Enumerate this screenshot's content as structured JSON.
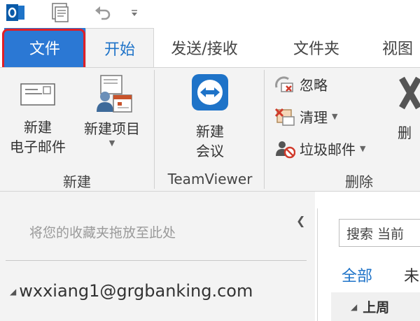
{
  "quick_access": {
    "app_icon": "outlook-icon",
    "icons": [
      "send-receive-icon",
      "undo-icon",
      "customize-dropdown-icon"
    ]
  },
  "tabs": {
    "file": "文件",
    "home": "开始",
    "send_receive": "发送/接收",
    "folder": "文件夹",
    "view": "视图"
  },
  "ribbon": {
    "new_group": {
      "new_email": [
        "新建",
        "电子邮件"
      ],
      "new_items": "新建项目",
      "label": "新建"
    },
    "teamviewer_group": {
      "new_meeting": [
        "新建",
        "会议"
      ],
      "label": "TeamViewer"
    },
    "delete_group": {
      "ignore": "忽略",
      "clean_up": "清理",
      "junk": "垃圾邮件",
      "delete": "删",
      "label": "删除"
    }
  },
  "nav_pane": {
    "favorites_hint": "将您的收藏夹拖放至此处",
    "account": "wxxiang1@grgbanking.com"
  },
  "message_list": {
    "search_placeholder": "搜索 当前",
    "filter_all": "全部",
    "filter_unread": "未",
    "group_header": "上周"
  },
  "colors": {
    "file_tab": "#2b78d4",
    "accent": "#1e73c8",
    "highlight_box": "#e01f26",
    "ribbon_bg": "#f3f3f3"
  }
}
